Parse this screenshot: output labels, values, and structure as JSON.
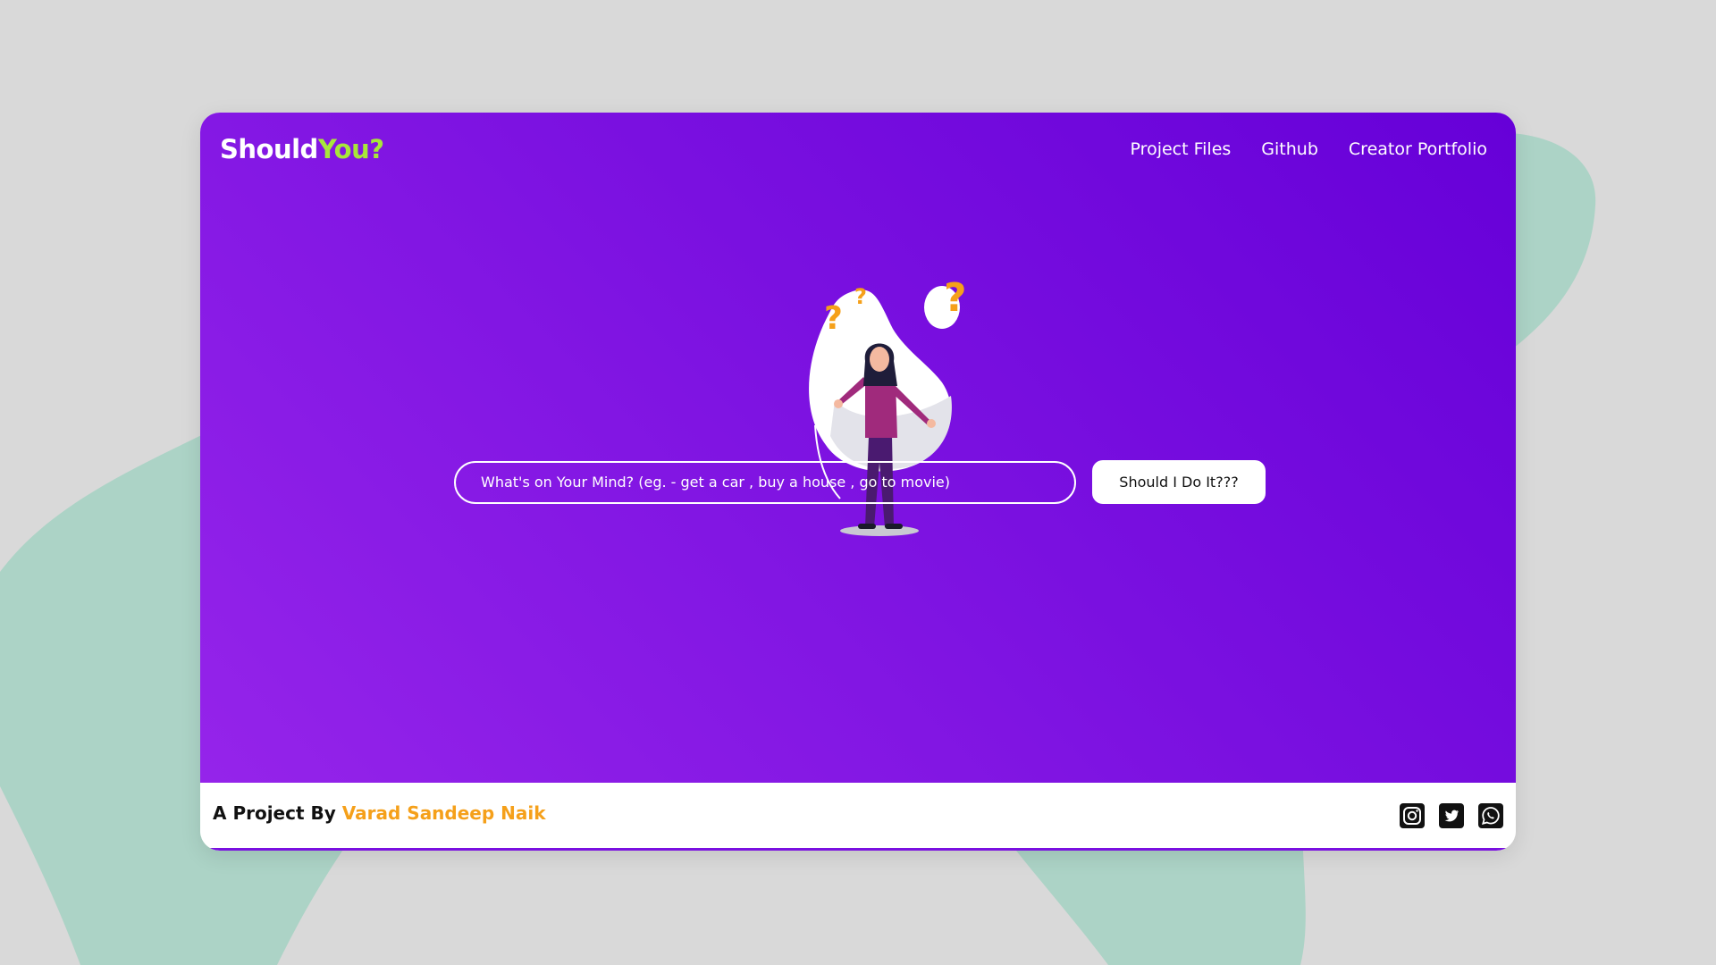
{
  "brand": {
    "name_part1": "Should",
    "name_part2": "You?",
    "accent_color": "#a8e63a"
  },
  "nav": {
    "items": [
      {
        "label": "Project Files"
      },
      {
        "label": "Github"
      },
      {
        "label": "Creator Portfolio"
      }
    ]
  },
  "search": {
    "placeholder": "What's on Your Mind? (eg. - get a car , buy a house , go to movie)",
    "value": ""
  },
  "action": {
    "button_label": "Should I Do It???"
  },
  "footer": {
    "credit_prefix": "A Project By",
    "credit_name": "Varad Sandeep Naik",
    "author_color": "#f5a01a",
    "social_icons": [
      "instagram-icon",
      "twitter-icon",
      "whatsapp-icon"
    ]
  },
  "colors": {
    "page_background": "#d9d9d9",
    "blob": "#acd3c6",
    "hero_gradient_start": "#6600d8",
    "hero_gradient_end": "#9524ea"
  }
}
